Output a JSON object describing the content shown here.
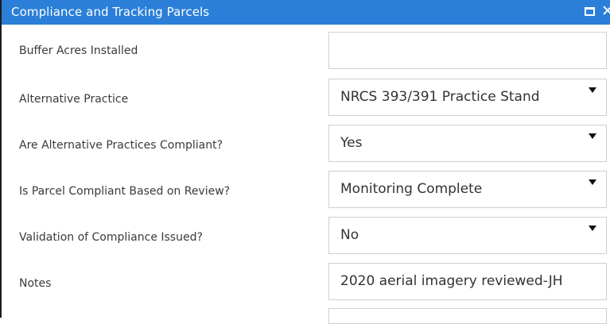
{
  "panel": {
    "title": "Compliance and Tracking Parcels",
    "maximize_icon": "maximize-icon",
    "close_glyph": "✕"
  },
  "fields": [
    {
      "label": "Buffer Acres Installed",
      "value": "",
      "type": "text"
    },
    {
      "label": "Alternative Practice",
      "value": "NRCS 393/391 Practice Stand",
      "type": "select"
    },
    {
      "label": "Are Alternative Practices Compliant?",
      "value": "Yes",
      "type": "select"
    },
    {
      "label": "Is Parcel Compliant Based on Review?",
      "value": "Monitoring Complete",
      "type": "select"
    },
    {
      "label": "Validation of Compliance Issued?",
      "value": "No",
      "type": "select"
    },
    {
      "label": "Notes",
      "value": "2020 aerial imagery reviewed-JH",
      "type": "text"
    }
  ],
  "colors": {
    "titlebar": "#2b7fd8",
    "border": "#cfcfcf"
  }
}
